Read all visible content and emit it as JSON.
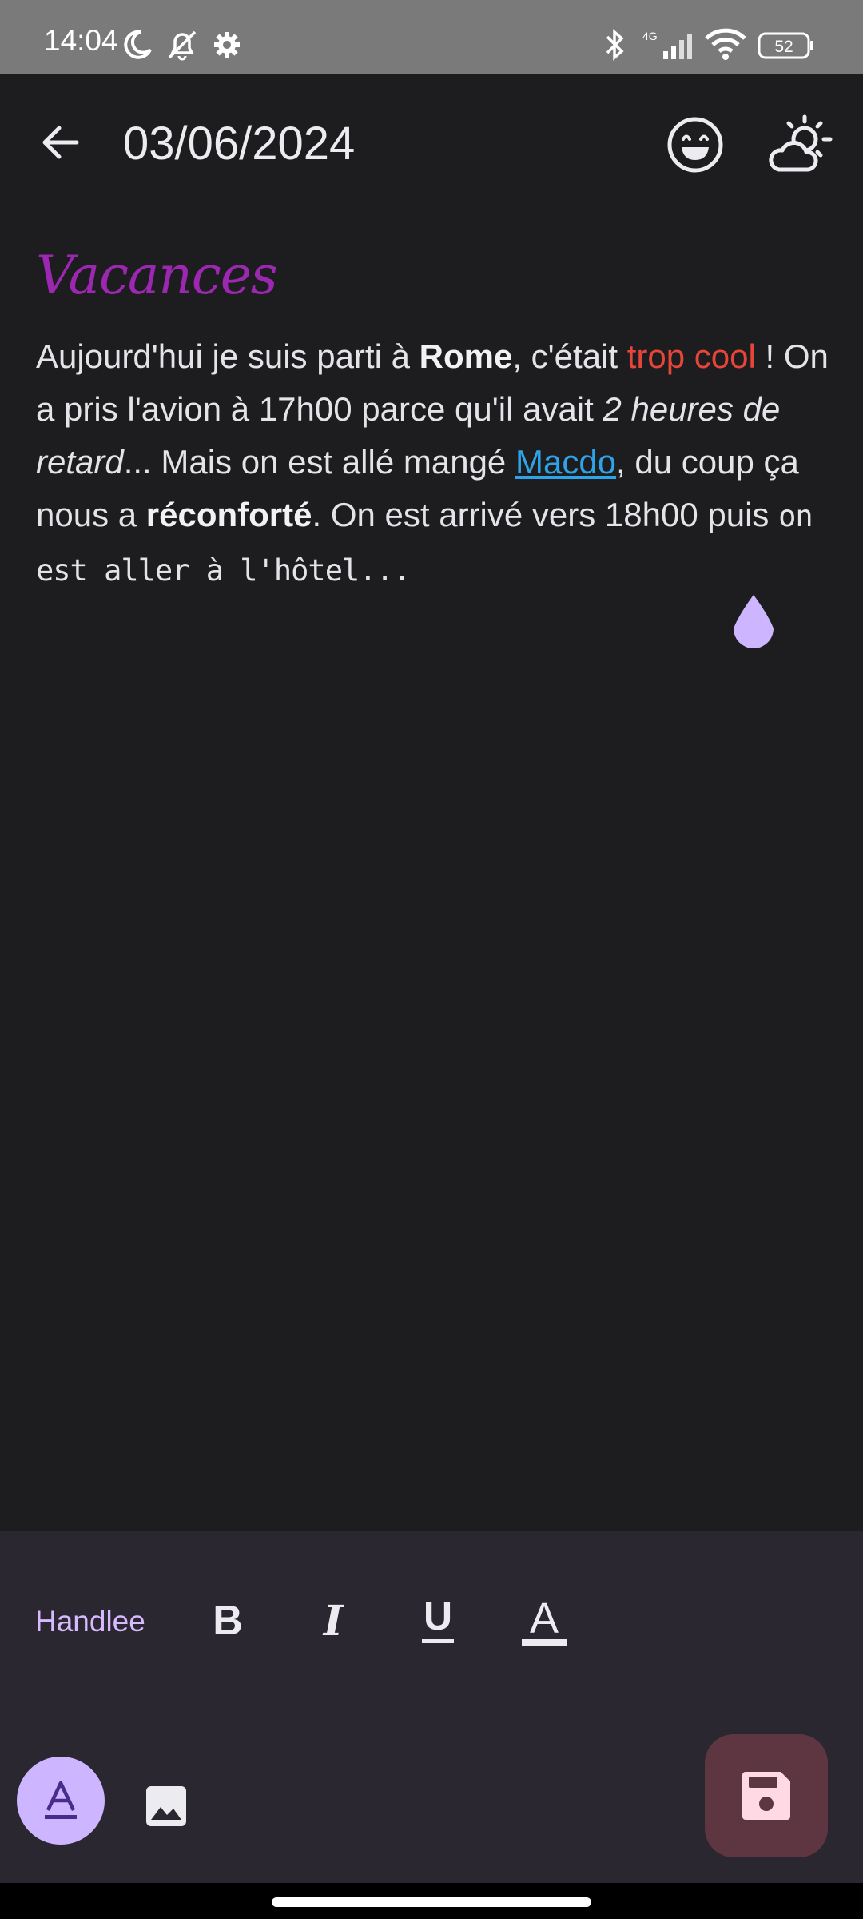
{
  "status_bar": {
    "time": "14:04",
    "battery": "52",
    "network": "4G",
    "icons": [
      "moon-icon",
      "alarm-off-icon",
      "gear-icon",
      "bluetooth-icon",
      "signal-icon",
      "wifi-icon",
      "battery-icon"
    ]
  },
  "app_bar": {
    "title": "03/06/2024",
    "back_icon": "arrow-back-icon",
    "mood_icon": "smiley-icon",
    "weather_icon": "partly-cloudy-icon"
  },
  "entry": {
    "title": "Vacances",
    "title_color": "#9c27b0",
    "body": {
      "p1": "Aujourd'hui je suis parti à ",
      "p2": "Rome",
      "p3": ", c'était ",
      "p4": "trop cool",
      "p5": " ! On a pris l'avion à 17h00 parce qu'il avait ",
      "p6": "2 heures de retard",
      "p7": "... Mais on est allé mangé ",
      "p8": "Macdo",
      "p9": ", du coup ça nous a ",
      "p10": "réconforté",
      "p11": ". On est arrivé vers 18h00 puis ",
      "p12": "on est aller à l'hôtel..."
    },
    "colors": {
      "red": "#e6453a",
      "link": "#2ea3e8"
    }
  },
  "toolbar": {
    "font_name": "Handlee",
    "bold_label": "B",
    "italic_label": "I",
    "underline_label": "U",
    "color_label": "A",
    "text_style_icon": "text-format-icon",
    "image_icon": "image-icon",
    "save_icon": "save-icon",
    "accent": "#cdb5ff",
    "fab_color": "#5d3641"
  }
}
